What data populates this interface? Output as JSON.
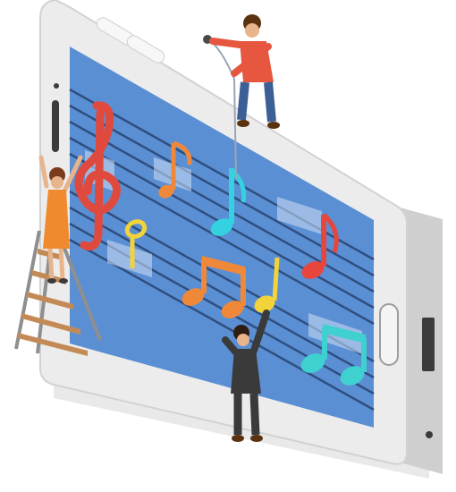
{
  "scene": {
    "icons": {
      "device": "smartphone-icon",
      "treble_clef": "treble-clef-icon",
      "notes": "music-note-icon",
      "ladder": "ladder-icon",
      "microphone": "microphone-icon"
    },
    "colors": {
      "background": "#ffffff",
      "phone_frame": "#ececec",
      "phone_edge": "#c8c8c8",
      "screen": "#5b8fd3",
      "staff_lines": "#2e4f80",
      "treble_clef": "#e04a3e",
      "note_orange": "#f0883a",
      "note_cyan": "#34d2e0",
      "note_yellow": "#f2d33a",
      "note_red": "#e8453c",
      "note_teal": "#3fd0d0",
      "shirt_red": "#e7573f",
      "dress_orange": "#f08a2e",
      "suit_dark": "#3a3a3a",
      "jeans": "#3c5f95",
      "ladder": "#c48a55"
    }
  }
}
